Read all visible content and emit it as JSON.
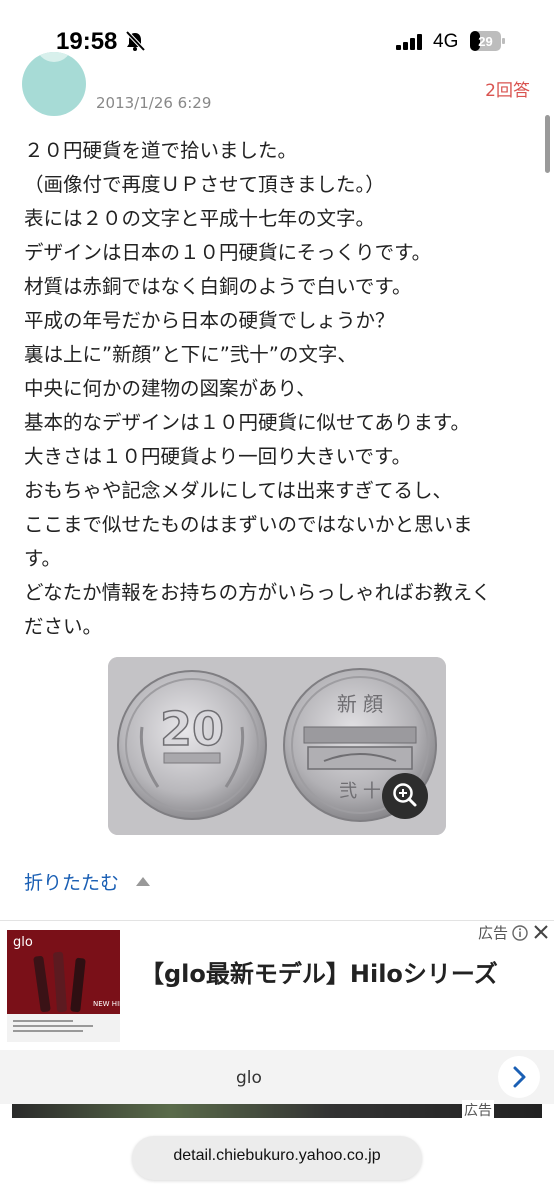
{
  "status_bar": {
    "time": "19:58",
    "network": "4G",
    "battery": "29"
  },
  "question": {
    "date": "2013/1/26 6:29",
    "answer_count": "2回答",
    "lines": [
      "２０円硬貨を道で拾いました。",
      "（画像付で再度ＵＰさせて頂きました。）",
      "表には２０の文字と平成十七年の文字。",
      "デザインは日本の１０円硬貨にそっくりです。",
      "材質は赤銅ではなく白銅のようで白いです。",
      "平成の年号だから日本の硬貨でしょうか？",
      "裏は上に”新顔”と下に”弐十”の文字、",
      "中央に何かの建物の図案があり、",
      "基本的なデザインは１０円硬貨に似せてあります。",
      "大きさは１０円硬貨より一回り大きいです。",
      "おもちゃや記念メダルにしては出来すぎてるし、",
      "ここまで似せたものはまずいのではないかと思いま",
      "す。",
      "どなたか情報をお持ちの方がいらっしゃればお教えく",
      "ださい。"
    ],
    "coin_front_text": "20",
    "coin_back_top": "新 顔",
    "coin_back_bottom": "弐 十",
    "collapse_label": "折りたたむ"
  },
  "ad": {
    "label": "広告",
    "title": "【glo最新モデル】Hiloシリーズ",
    "brand": "glo",
    "image_logo": "glo",
    "image_badge": "NEW HILO"
  },
  "ad2": {
    "label": "広告"
  },
  "browser": {
    "url": "detail.chiebukuro.yahoo.co.jp"
  },
  "colors": {
    "accent_link": "#1a5fb4",
    "answer_red": "#d9534f",
    "ad_bg": "#7a1018"
  },
  "icons": [
    "bell-slash-icon",
    "signal-icon",
    "battery-icon",
    "zoom-in-icon",
    "info-icon",
    "close-icon",
    "chevron-right-icon",
    "triangle-up-icon"
  ]
}
